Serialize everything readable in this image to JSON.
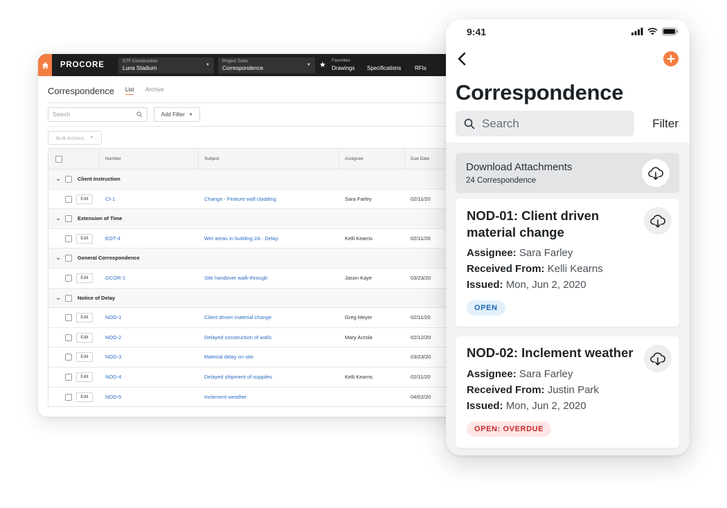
{
  "desktop": {
    "logo": "PROCORE",
    "company": {
      "caption": "STF Construction",
      "value": "Luna Stadium"
    },
    "tools": {
      "caption": "Project Tools",
      "value": "Correspondence"
    },
    "favorites": {
      "caption": "Favorites",
      "value": "Drawings"
    },
    "nav_links": [
      "Specifications",
      "RFIs"
    ],
    "page_title": "Correspondence",
    "tabs": [
      "List",
      "Archive"
    ],
    "search_placeholder": "Search",
    "add_filter_label": "Add Filter",
    "bulk_actions_label": "Bulk Actions",
    "edit_label": "Edit",
    "columns": [
      "Number",
      "Subject",
      "Assignee",
      "Due Date"
    ],
    "groups": [
      {
        "label": "Client Instruction",
        "rows": [
          {
            "number": "CI-1",
            "subject": "Change - Feature wall cladding",
            "assignee": "Sara Farley",
            "due": "02/11/20"
          }
        ]
      },
      {
        "label": "Extension of Time",
        "rows": [
          {
            "number": "EOT-4",
            "subject": "Wet areas in building 2A - Delay",
            "assignee": "Kelli Kearns",
            "due": "02/11/20"
          }
        ]
      },
      {
        "label": "General Correspondence",
        "rows": [
          {
            "number": "GCOR-1",
            "subject": "Site handover walk-through",
            "assignee": "Jason Kaye",
            "due": "03/23/20"
          }
        ]
      },
      {
        "label": "Notice of Delay",
        "rows": [
          {
            "number": "NOD-1",
            "subject": "Client driven material change",
            "assignee": "Greg Meyer",
            "due": "02/11/20"
          },
          {
            "number": "NOD-2",
            "subject": "Delayed construction of walls",
            "assignee": "Mary Arzola",
            "due": "02/12/20"
          },
          {
            "number": "NOD-3",
            "subject": "Material delay on site",
            "assignee": "",
            "due": "03/23/20"
          },
          {
            "number": "NOD-4",
            "subject": "Delayed shipment of suppiles",
            "assignee": "Kelli Kearns",
            "due": "02/11/20"
          },
          {
            "number": "NOD-5",
            "subject": "Inclement weather",
            "assignee": "",
            "due": "04/02/20"
          }
        ]
      }
    ]
  },
  "phone": {
    "time": "9:41",
    "title": "Correspondence",
    "search_placeholder": "Search",
    "filter_label": "Filter",
    "download": {
      "title": "Download Attachments",
      "subtitle": "24 Correspondence"
    },
    "cards": [
      {
        "title": "NOD-01: Client driven material change",
        "assignee_label": "Assignee:",
        "assignee": "Sara Farley",
        "received_label": "Received From:",
        "received": "Kelli Kearns",
        "issued_label": "Issued:",
        "issued": "Mon, Jun 2, 2020",
        "status": "OPEN"
      },
      {
        "title": "NOD-02: Inclement weather",
        "assignee_label": "Assignee:",
        "assignee": "Sara Farley",
        "received_label": "Received From:",
        "received": "Justin Park",
        "issued_label": "Issued:",
        "issued": "Mon, Jun 2, 2020",
        "status": "OPEN: OVERDUE"
      }
    ]
  },
  "colors": {
    "brand_orange": "#f47e42",
    "link_blue": "#2c6ec4",
    "open_blue": "#2066b1",
    "overdue_red": "#c9272b"
  }
}
